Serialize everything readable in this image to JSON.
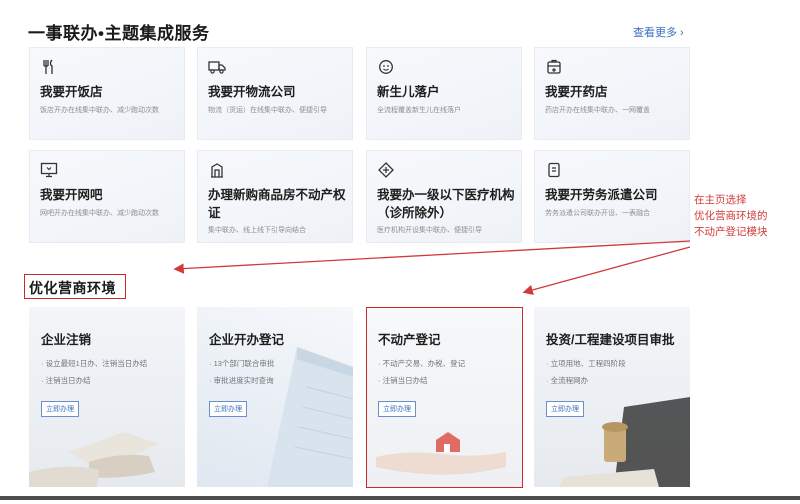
{
  "header": {
    "title": "一事联办•主题集成服务",
    "more_link": "查看更多 ›"
  },
  "services": [
    {
      "icon": "utensils-icon",
      "title": "我要开饭店",
      "desc": "饭店开办在线集中联办、减少跑动次数"
    },
    {
      "icon": "truck-icon",
      "title": "我要开物流公司",
      "desc": "物流（货运）在线集中联办、便捷引导"
    },
    {
      "icon": "baby-icon",
      "title": "新生儿落户",
      "desc": "全流程覆盖新生儿在线落户"
    },
    {
      "icon": "pharmacy-icon",
      "title": "我要开药店",
      "desc": "药店开办在线集中联办、一网覆盖"
    },
    {
      "icon": "monitor-icon",
      "title": "我要开网吧",
      "desc": "网吧开办在线集中联办、减少跑动次数"
    },
    {
      "icon": "building-icon",
      "title": "办理新购商品房不动产权证",
      "desc": "集中联办、线上线下引导向结合"
    },
    {
      "icon": "medical-cross-icon",
      "title": "我要办一级以下医疗机构（诊所除外）",
      "desc": "医疗机构开设集中联办、便捷引导"
    },
    {
      "icon": "document-icon",
      "title": "我要开劳务派遣公司",
      "desc": "劳务派遣公司联办开设、一表融合"
    }
  ],
  "annotation": {
    "lines": [
      "在主页选择",
      "优化营商环境的",
      "不动产登记模块"
    ]
  },
  "business_env": {
    "title": "优化营商环境",
    "cards": [
      {
        "title": "企业注销",
        "lines": [
          "· 设立最短1日办、注销当日办结",
          "· 注销当日办结"
        ],
        "button": "立即办理"
      },
      {
        "title": "企业开办登记",
        "lines": [
          "· 13个部门联合审批",
          "· 审批进度实时查询"
        ],
        "button": "立即办理"
      },
      {
        "title": "不动产登记",
        "lines": [
          "· 不动产交易、办税、登记",
          "· 注销当日办结"
        ],
        "button": "立即办理"
      },
      {
        "title": "投资/工程建设项目审批",
        "lines": [
          "· 立项用地、工程四阶段",
          "· 全流程网办"
        ],
        "button": "立即办理"
      }
    ]
  },
  "colors": {
    "accent": "#3a6fc4",
    "annotation": "#d23a3a",
    "highlight": "#c92b2b"
  }
}
